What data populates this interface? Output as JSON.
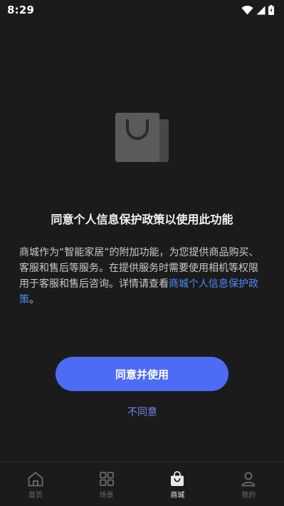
{
  "status_bar": {
    "time": "8:29"
  },
  "consent": {
    "title": "同意个人信息保护政策以使用此功能",
    "body_text": "商城作为“智能家居”的附加功能，为您提供商品购买、客服和售后等服务。在提供服务时需要使用相机等权限用于客服和售后咨询。详情请查看",
    "policy_link": "商城个人信息保护政策",
    "body_end": "。"
  },
  "actions": {
    "agree_label": "同意并使用",
    "disagree_label": "不同意"
  },
  "bottom_nav": {
    "items": [
      {
        "label": "首页",
        "icon": "home-icon",
        "active": false
      },
      {
        "label": "场景",
        "icon": "grid-icon",
        "active": false
      },
      {
        "label": "商城",
        "icon": "shopping-bag-icon",
        "active": true
      },
      {
        "label": "我的",
        "icon": "person-icon",
        "active": false
      }
    ]
  },
  "colors": {
    "background": "#1b1b1b",
    "accent": "#4d6bf5",
    "link": "#4a8cf7",
    "disagree": "#6f87f5"
  }
}
